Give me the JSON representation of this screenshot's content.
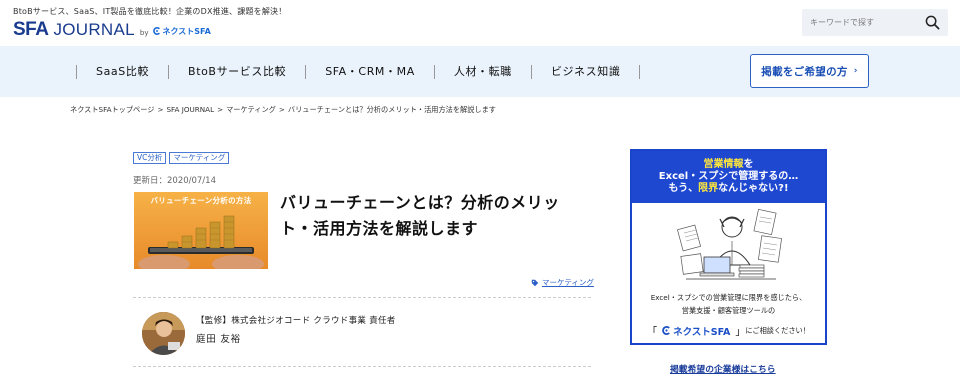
{
  "header": {
    "tagline": "BtoBサービス、SaaS、IT製品を徹底比較！企業のDX推進、課題を解決！",
    "logo_sfa": "SFA",
    "logo_journal": "JOURNAL",
    "logo_by": "by",
    "logo_brand": "ネクストSFA",
    "search_placeholder": "キーワードで探す"
  },
  "nav": {
    "items": [
      {
        "label": "SaaS比較"
      },
      {
        "label": "BtoBサービス比較"
      },
      {
        "label": "SFA・CRM・MA"
      },
      {
        "label": "人材・転職"
      },
      {
        "label": "ビジネス知識"
      }
    ],
    "cta_label": "掲載をご希望の方",
    "cta_chevron": "›"
  },
  "breadcrumb": {
    "items": [
      "ネクストSFAトップページ",
      "SFA JOURNAL",
      "マーケティング",
      "バリューチェーンとは？分析のメリット・活用方法を解説します"
    ],
    "separator": ">"
  },
  "article": {
    "tags": [
      "VC分析",
      "マーケティング"
    ],
    "updated": "更新日：2020/07/14",
    "thumbnail_title": "バリューチェーン分析の方法",
    "title": "バリューチェーンとは？分析のメリット・活用方法を解説します",
    "category_link": "マーケティング"
  },
  "supervisor": {
    "role": "【監修】株式会社ジオコード クラウド事業 責任者",
    "name": "庭田 友裕"
  },
  "ad": {
    "headline_1_hl": "営業情報",
    "headline_1_rest": "を",
    "headline_2": "Excel・スプシで管理するの…",
    "headline_3_pre": "もう、",
    "headline_3_hl": "限界",
    "headline_3_post": "なんじゃない?!",
    "body_1": "Excel・スプシでの営業管理に限界を感じたら、",
    "body_2": "営業支援・顧客管理ツールの",
    "bracket_open": "「",
    "brand": "ネクストSFA",
    "bracket_close": "」",
    "body_3": "にご相談ください！",
    "link": "掲載希望の企業様はこちら"
  },
  "colors": {
    "brand_blue": "#1a3c8f",
    "nav_bg": "#eaf3fc",
    "ad_blue": "#1f48d1",
    "highlight_yellow": "#ffe83a"
  }
}
